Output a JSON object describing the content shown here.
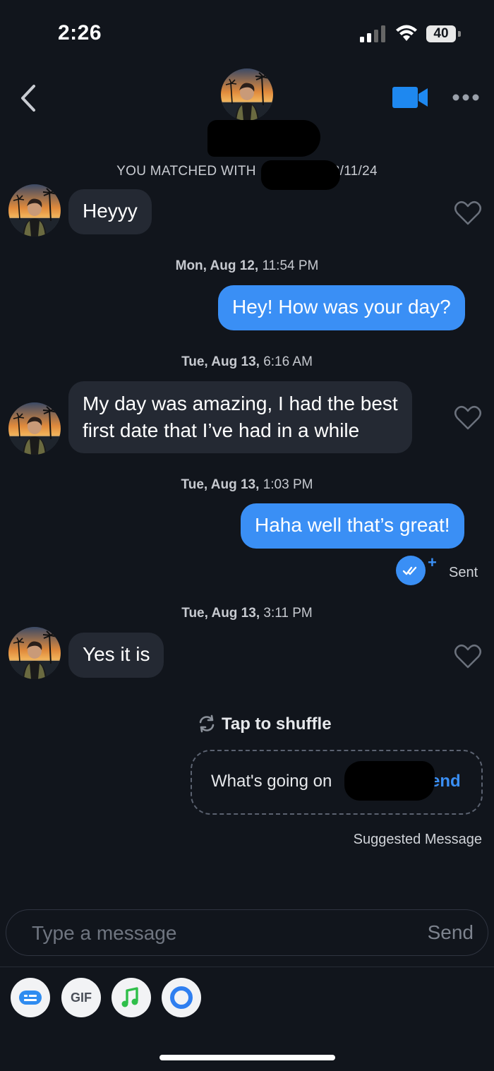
{
  "status_bar": {
    "time": "2:26",
    "battery": "40"
  },
  "header": {
    "back_icon": "chevron-left-icon",
    "video_icon": "video-camera-icon",
    "more_icon": "more-horizontal-icon",
    "match_prefix": "YOU MATCHED WITH",
    "match_date_suffix": "3/11/24"
  },
  "messages": [
    {
      "type": "in",
      "text": "Heyyy"
    },
    {
      "type": "timestamp",
      "date": "Mon, Aug 12,",
      "time": "11:54 PM"
    },
    {
      "type": "out",
      "text": "Hey! How was your day?"
    },
    {
      "type": "timestamp",
      "date": "Tue, Aug 13,",
      "time": "6:16 AM"
    },
    {
      "type": "in",
      "lines": [
        "My day was amazing, I had the best",
        "first date that I’ve had in a while"
      ]
    },
    {
      "type": "timestamp",
      "date": "Tue, Aug 13,",
      "time": "1:03 PM"
    },
    {
      "type": "out",
      "text": "Haha well that’s great!",
      "status": "Sent"
    },
    {
      "type": "timestamp",
      "date": "Tue, Aug 13,",
      "time": "3:11 PM"
    },
    {
      "type": "in",
      "text": "Yes it is"
    }
  ],
  "suggestion": {
    "shuffle_label": "Tap to shuffle",
    "text": "What's going on",
    "send_label": "Send",
    "caption": "Suggested Message"
  },
  "composer": {
    "placeholder": "Type a message",
    "send_label": "Send"
  },
  "toolbar": {
    "items": [
      {
        "icon": "sticker-card-icon"
      },
      {
        "label": "GIF"
      },
      {
        "icon": "music-note-icon"
      },
      {
        "icon": "ring-icon"
      }
    ]
  },
  "colors": {
    "background": "#11151c",
    "incoming_bubble": "#242933",
    "outgoing_bubble": "#3a8ff5",
    "accent": "#3a8ff5"
  }
}
